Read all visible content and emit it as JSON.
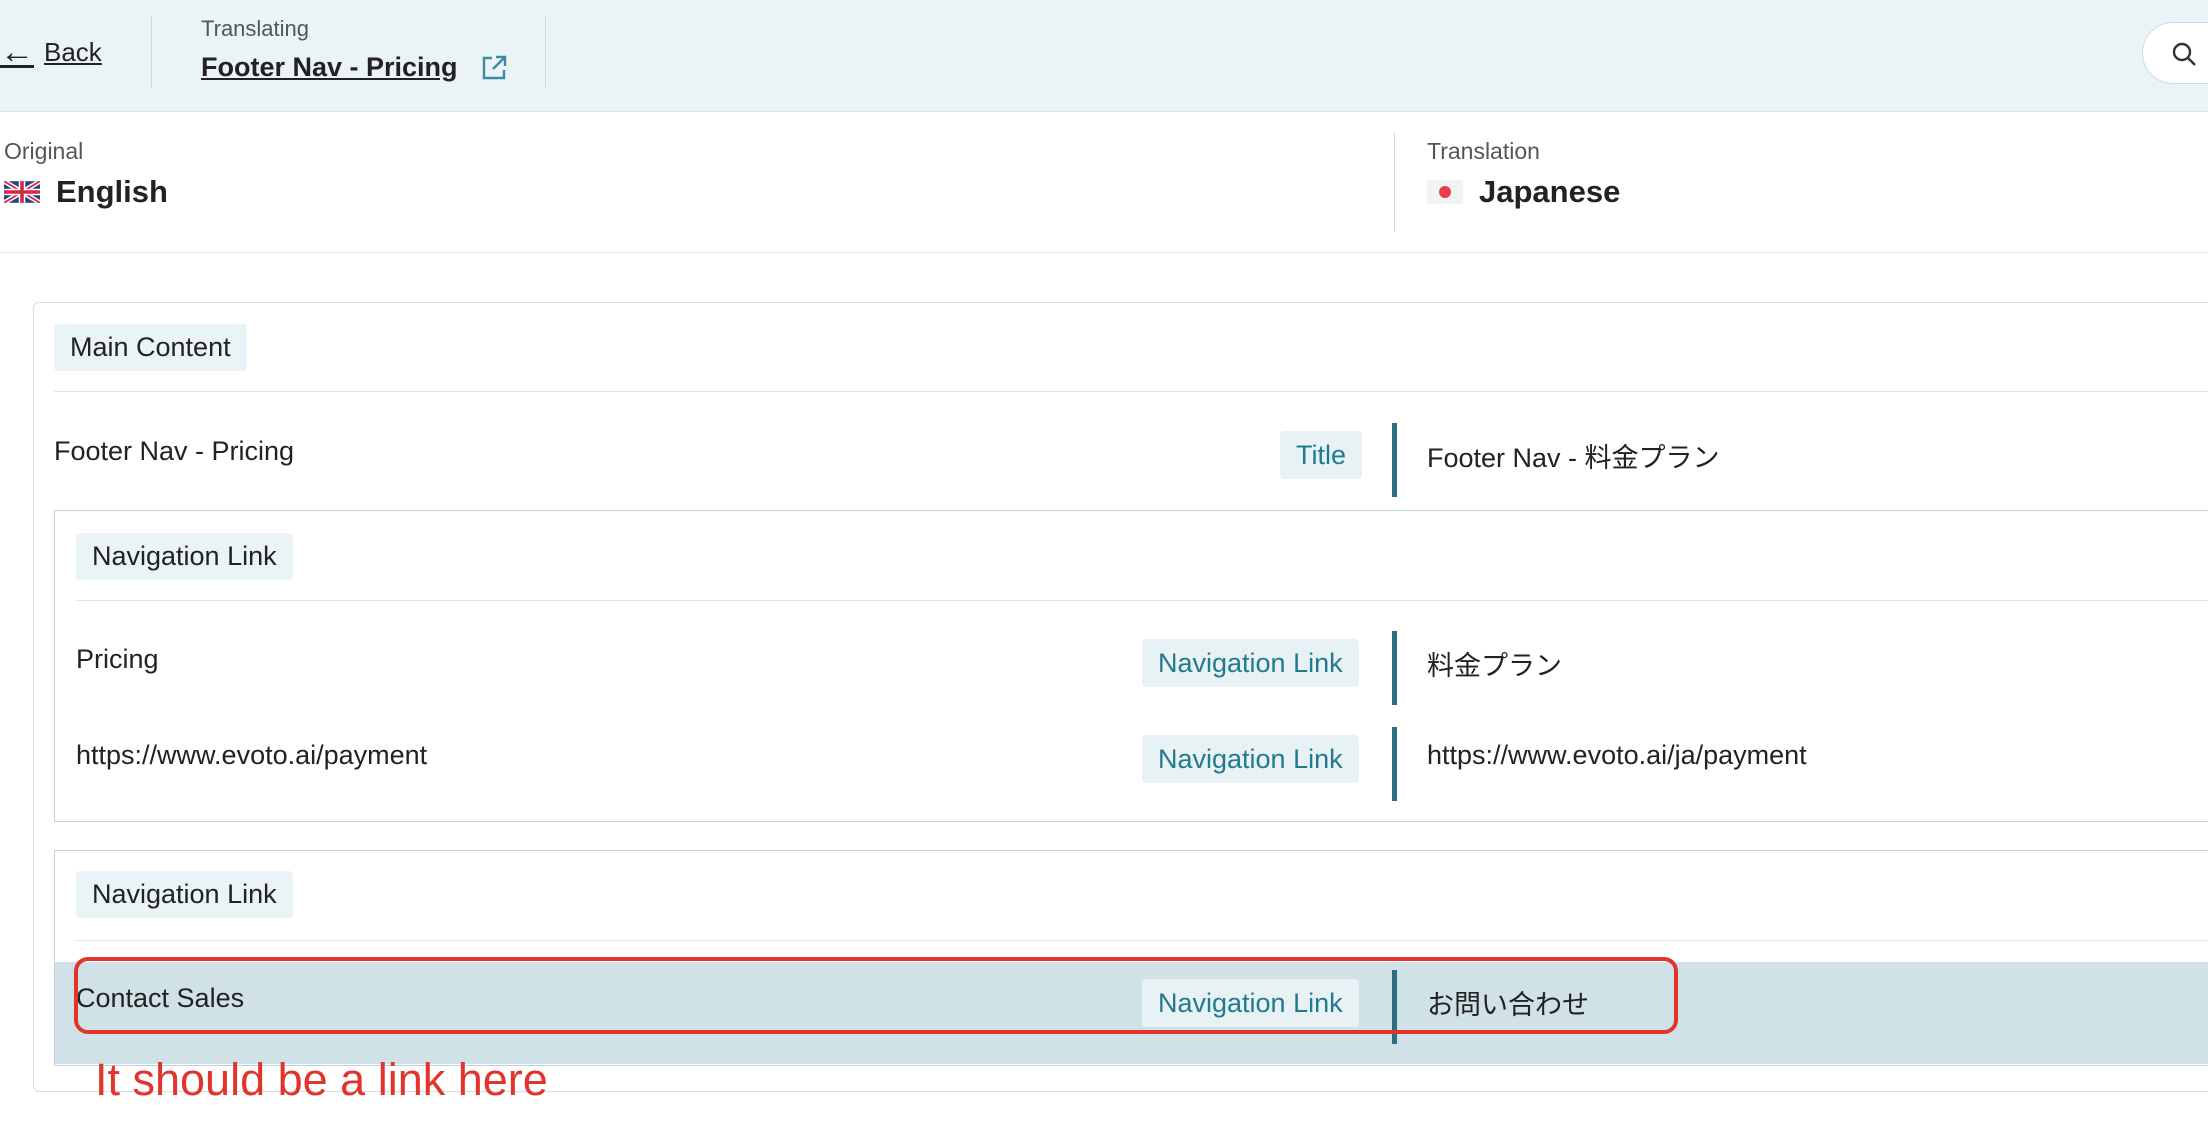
{
  "header": {
    "back_label": "Back",
    "back_arrow": "←",
    "translating_label": "Translating",
    "document_title": "Footer Nav - Pricing",
    "external_icon": "external-link-icon",
    "search_icon": "search-icon"
  },
  "languages": {
    "original_label": "Original",
    "original_name": "English",
    "original_flag": "uk-flag-icon",
    "translation_label": "Translation",
    "translation_name": "Japanese",
    "translation_flag": "japan-flag-icon"
  },
  "sections": {
    "main_chip": "Main Content",
    "title_row": {
      "source": "Footer Nav - Pricing",
      "tag": "Title",
      "translation": "Footer Nav - 料金プラン"
    },
    "nav_group_1": {
      "chip": "Navigation Link",
      "rows": [
        {
          "source": "Pricing",
          "tag": "Navigation Link",
          "translation": "料金プラン"
        },
        {
          "source": "https://www.evoto.ai/payment",
          "tag": "Navigation Link",
          "translation": "https://www.evoto.ai/ja/payment"
        }
      ]
    },
    "nav_group_2": {
      "chip": "Navigation Link",
      "rows": [
        {
          "source": "Contact Sales",
          "tag": "Navigation Link",
          "translation": "お問い合わせ"
        }
      ]
    }
  },
  "annotation": {
    "text": "It should be a link here",
    "color": "#e0342c"
  },
  "colors": {
    "header_bg": "#eaf3f6",
    "accent": "#227a8f",
    "divider_bar": "#2f6e80",
    "highlight_row": "#d0e1e7"
  }
}
